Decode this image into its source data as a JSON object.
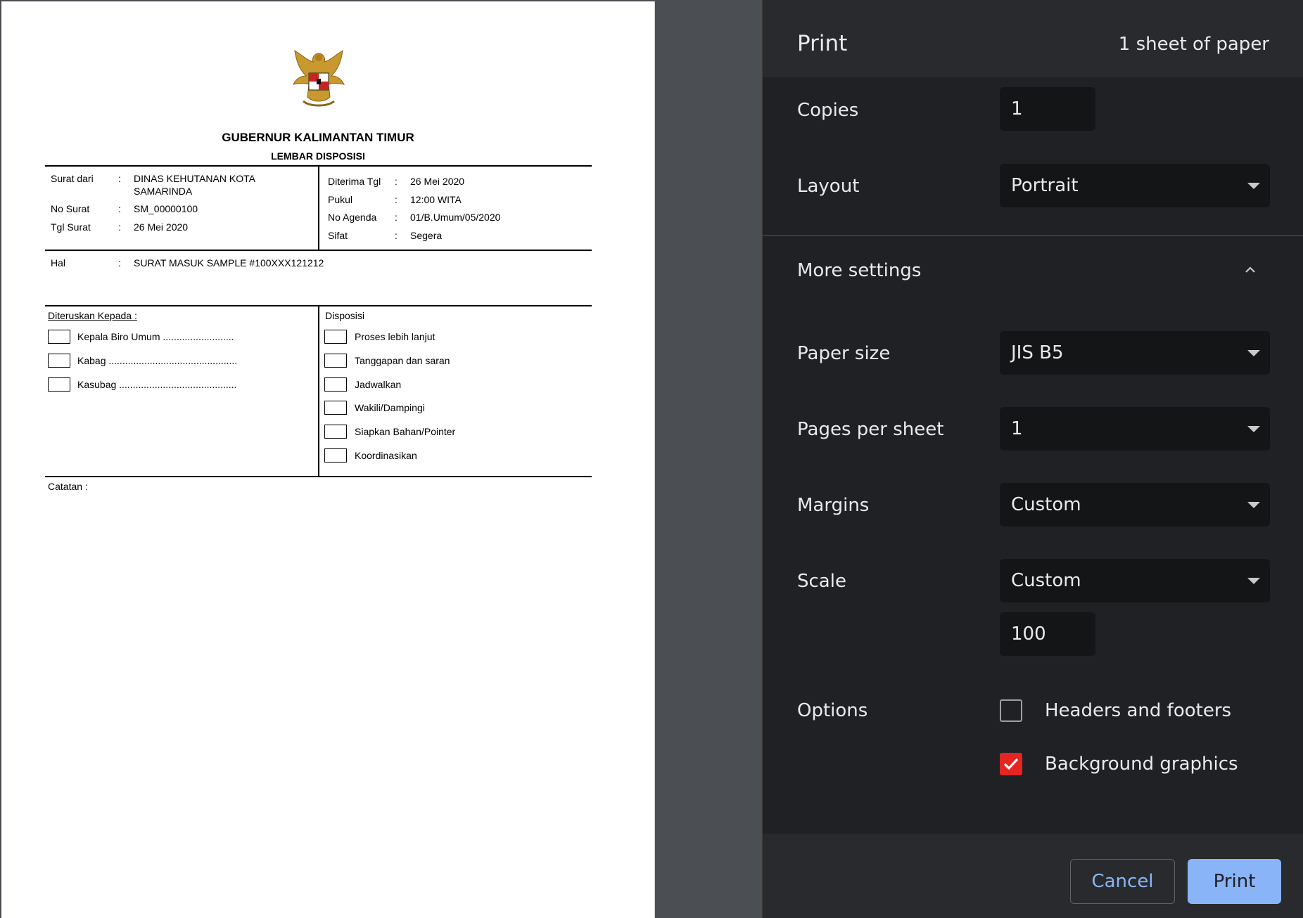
{
  "document": {
    "title": "GUBERNUR KALIMANTAN TIMUR",
    "subtitle": "LEMBAR DISPOSISI",
    "left_fields": [
      {
        "label": "Surat dari",
        "sep": ":",
        "value": "DINAS KEHUTANAN KOTA",
        "value2": "SAMARINDA"
      },
      {
        "label": "No Surat",
        "sep": ":",
        "value": "SM_00000100"
      },
      {
        "label": "Tgl Surat",
        "sep": ":",
        "value": "26 Mei 2020"
      }
    ],
    "right_fields": [
      {
        "label": "Diterima Tgl",
        "sep": ":",
        "value": "26 Mei 2020"
      },
      {
        "label": "Pukul",
        "sep": ":",
        "value": "12:00 WITA"
      },
      {
        "label": "No Agenda",
        "sep": ":",
        "value": "01/B.Umum/05/2020"
      },
      {
        "label": "Sifat",
        "sep": ":",
        "value": "Segera"
      }
    ],
    "hal": {
      "label": "Hal",
      "sep": ":",
      "value": "SURAT MASUK SAMPLE #100XXX121212"
    },
    "forwarded_heading": "Diteruskan Kepada :",
    "forwarded_to": [
      "Kepala Biro Umum ..........................",
      "Kabag ...............................................",
      "Kasubag ..........................................."
    ],
    "disposition_heading": "Disposisi",
    "dispositions": [
      "Proses lebih lanjut",
      "Tanggapan dan saran",
      "Jadwalkan",
      "Wakili/Dampingi",
      "Siapkan Bahan/Pointer",
      "Koordinasikan"
    ],
    "notes_label": "Catatan :"
  },
  "panel": {
    "title": "Print",
    "sheet_count": "1 sheet of paper",
    "copies": {
      "label": "Copies",
      "value": "1"
    },
    "layout": {
      "label": "Layout",
      "value": "Portrait"
    },
    "more_settings": "More settings",
    "paper_size": {
      "label": "Paper size",
      "value": "JIS B5"
    },
    "pages_per_sheet": {
      "label": "Pages per sheet",
      "value": "1"
    },
    "margins": {
      "label": "Margins",
      "value": "Custom"
    },
    "scale": {
      "label": "Scale",
      "value": "Custom",
      "custom_value": "100"
    },
    "options": {
      "label": "Options",
      "headers_footers": {
        "label": "Headers and footers",
        "checked": false
      },
      "background_graphics": {
        "label": "Background graphics",
        "checked": true
      }
    },
    "cancel_label": "Cancel",
    "print_label": "Print"
  },
  "colors": {
    "accent": "#8ab4f8",
    "checkbox_checked": "#e52521",
    "panel_bg": "#202124",
    "preview_bg": "#4b4e53"
  }
}
